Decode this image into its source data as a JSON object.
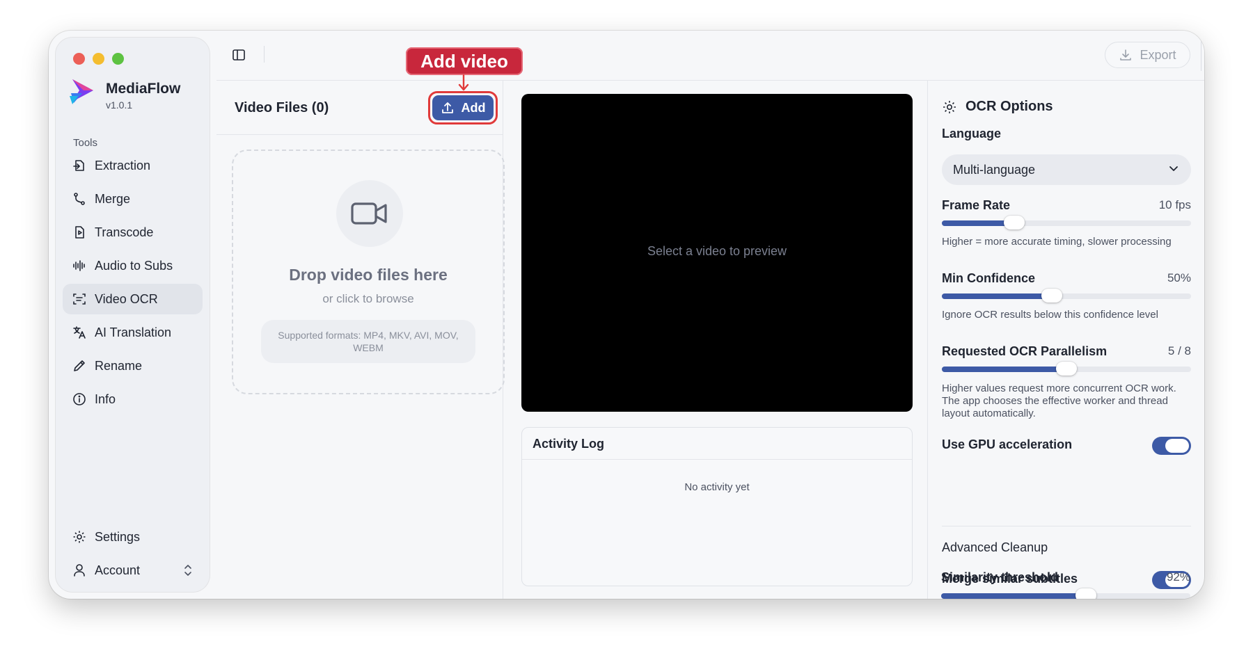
{
  "app": {
    "name": "MediaFlow",
    "version": "v1.0.1"
  },
  "sidebar": {
    "section_label": "Tools",
    "items": [
      {
        "label": "Extraction",
        "icon": "extraction-icon",
        "active": false
      },
      {
        "label": "Merge",
        "icon": "merge-icon",
        "active": false
      },
      {
        "label": "Transcode",
        "icon": "transcode-icon",
        "active": false
      },
      {
        "label": "Audio to Subs",
        "icon": "waveform-icon",
        "active": false
      },
      {
        "label": "Video OCR",
        "icon": "ocr-icon",
        "active": true
      },
      {
        "label": "AI Translation",
        "icon": "translate-icon",
        "active": false
      },
      {
        "label": "Rename",
        "icon": "pencil-icon",
        "active": false
      },
      {
        "label": "Info",
        "icon": "info-icon",
        "active": false
      }
    ],
    "bottom": {
      "settings_label": "Settings",
      "account_label": "Account"
    }
  },
  "toolbar": {
    "export_label": "Export"
  },
  "annotation": {
    "callout_label": "Add video",
    "color": "#c8273c"
  },
  "files": {
    "title": "Video Files (0)",
    "add_label": "Add",
    "drop_title": "Drop video files here",
    "drop_subtitle": "or click to browse",
    "formats": "Supported formats: MP4, MKV, AVI, MOV, WEBM"
  },
  "preview": {
    "placeholder": "Select a video to preview"
  },
  "activity_log": {
    "title": "Activity Log",
    "empty": "No activity yet"
  },
  "ocr_options": {
    "title": "OCR Options",
    "language": {
      "label": "Language",
      "selected": "Multi-language"
    },
    "frame_rate": {
      "label": "Frame Rate",
      "value_text": "10 fps",
      "fraction": 0.29,
      "help": "Higher = more accurate timing, slower processing"
    },
    "min_confidence": {
      "label": "Min Confidence",
      "value_text": "50%",
      "fraction": 0.44,
      "help": "Ignore OCR results below this confidence level"
    },
    "parallelism": {
      "label": "Requested OCR Parallelism",
      "value_text": "5 / 8",
      "fraction": 0.5,
      "help": "Higher values request more concurrent OCR work. The app chooses the effective worker and thread layout automatically."
    },
    "gpu": {
      "label": "Use GPU acceleration",
      "on": true
    },
    "advanced_title": "Advanced Cleanup",
    "merge_similar": {
      "label": "Merge similar subtitles",
      "on": true
    },
    "similarity": {
      "label": "Similarity threshold",
      "value_text": "92%",
      "fraction": 0.58
    }
  },
  "colors": {
    "accent": "#3d5aa6",
    "highlight_border": "#e03a3a"
  }
}
